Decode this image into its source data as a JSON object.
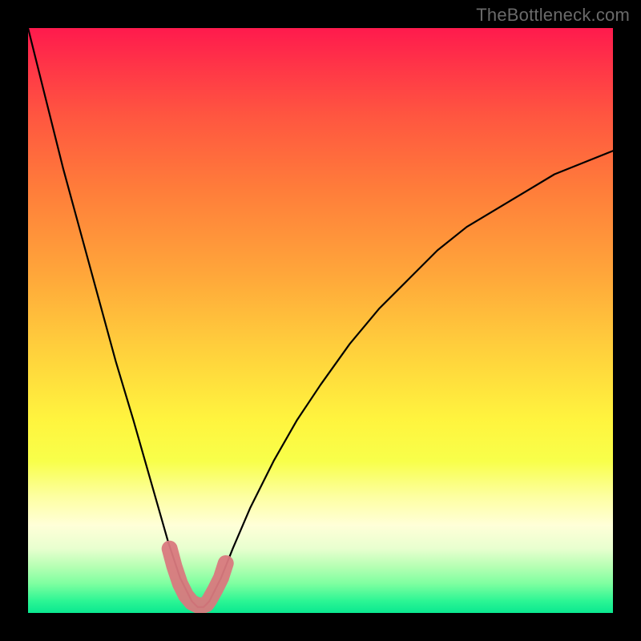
{
  "watermark": {
    "text": "TheBottleneck.com"
  },
  "chart_data": {
    "type": "line",
    "title": "",
    "xlabel": "",
    "ylabel": "",
    "xlim": [
      0,
      100
    ],
    "ylim": [
      0,
      100
    ],
    "grid": false,
    "series": [
      {
        "name": "bottleneck-curve",
        "x": [
          0,
          3,
          6,
          9,
          12,
          15,
          18,
          20,
          22,
          24,
          25,
          26,
          27,
          28,
          29,
          30,
          31,
          32,
          33,
          35,
          38,
          42,
          46,
          50,
          55,
          60,
          65,
          70,
          75,
          80,
          85,
          90,
          95,
          100
        ],
        "y": [
          100,
          88,
          76,
          65,
          54,
          43,
          33,
          26,
          19,
          12,
          9,
          6,
          4,
          2,
          1,
          1,
          2,
          4,
          6,
          11,
          18,
          26,
          33,
          39,
          46,
          52,
          57,
          62,
          66,
          69,
          72,
          75,
          77,
          79
        ]
      }
    ],
    "valley_highlight": {
      "name": "valley-marker",
      "x": [
        24.2,
        25,
        26,
        27,
        28,
        29,
        29.5,
        30,
        30.5,
        31,
        32,
        33,
        33.8
      ],
      "y": [
        11,
        8,
        5,
        3,
        1.8,
        1.3,
        1.3,
        1.3,
        1.5,
        2.2,
        4,
        6,
        8.5
      ]
    }
  }
}
